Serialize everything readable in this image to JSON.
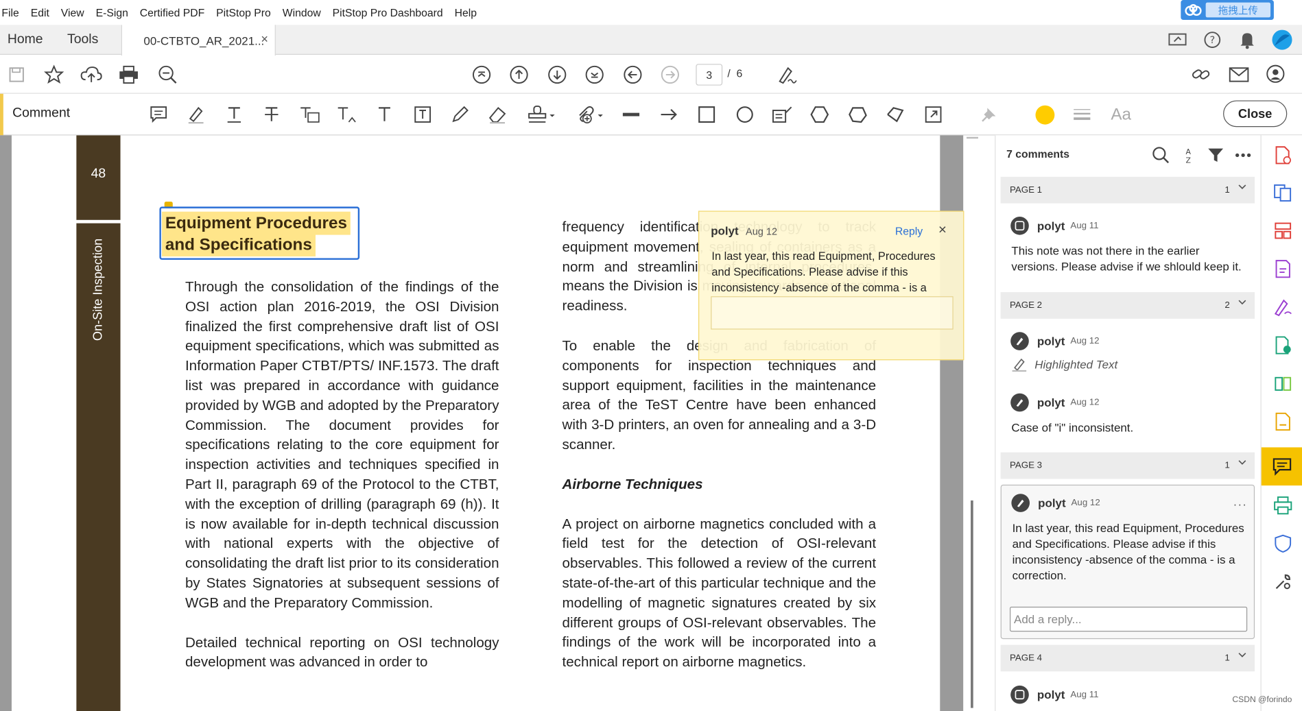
{
  "menu": [
    "File",
    "Edit",
    "View",
    "E-Sign",
    "Certified PDF",
    "PitStop Pro",
    "Window",
    "PitStop Pro Dashboard",
    "Help"
  ],
  "upload_badge": "拖拽上传",
  "tabs": {
    "home": "Home",
    "tools": "Tools",
    "document": "00-CTBTO_AR_2021...",
    "close_glyph": "×"
  },
  "toolbar": {
    "current_page": "3",
    "page_separator": "/",
    "total_pages": "6"
  },
  "comment_toolbar": {
    "title": "Comment",
    "close_label": "Close",
    "text_tool_label": "Aa",
    "color": "#ffcc00"
  },
  "document": {
    "page_number": "48",
    "section_label": "On-Site Inspection",
    "heading_line1": "Equipment Procedures",
    "heading_line2": "and Specifications",
    "col1_p1": "Through the consolidation of the findings of the OSI action plan 2016-2019, the OSI Division finalized the first comprehensive draft list of OSI equipment specifications, which was submitted as Information Paper CTBT/PTS/ INF.1573. The draft list was prepared in accordance with guidance provided by WGB and adopted by the Preparatory Commission. The document provides for specifications relating to the core equipment for inspection activities and techniques specified in Part II, paragraph 69 of the Protocol to the CTBT, with the exception of drilling (paragraph 69 (h)). It is now available for in-depth technical discussion with national experts with the objective of consolidating the draft list prior to its consideration by States Signatories at subsequent sessions of WGB and the Preparatory Commission.",
    "col1_p2": "Detailed technical reporting on OSI technology development was advanced in order to",
    "col2_p1": "frequency identification technology to track equipment movement, sealing of containers as a norm and streamlining of internal procedures, means the Division is moving towards operational readiness.",
    "col2_p2": "To enable the design and fabrication of components for inspection techniques and support equipment, facilities in the maintenance area of the TeST Centre have been enhanced with 3-D printers, an oven for annealing and a 3-D scanner.",
    "col2_heading": "Airborne Techniques",
    "col2_p3": "A project on airborne magnetics concluded with a field test for the detection of OSI-relevant observables. This followed a review of the current state-of-the-art of this particular technique and the modelling of magnetic signatures created by six different groups of OSI-relevant observables. The findings of the work will be incorporated into a technical report on airborne magnetics."
  },
  "popup": {
    "author": "polyt",
    "date": "Aug 12",
    "reply_label": "Reply",
    "close_glyph": "×",
    "body": "In last year, this read Equipment, Procedures and Specifications. Please advise if this inconsistency -absence of the comma - is a"
  },
  "comments_panel": {
    "count_label": "7 comments",
    "groups": [
      {
        "label": "PAGE 1",
        "count": "1"
      },
      {
        "label": "PAGE 2",
        "count": "2"
      },
      {
        "label": "PAGE 3",
        "count": "1"
      },
      {
        "label": "PAGE 4",
        "count": "1"
      }
    ],
    "comments": [
      {
        "author": "polyt",
        "date": "Aug 11",
        "text": "This note was not there in the earlier versions. Please advise if we shlould keep it."
      },
      {
        "author": "polyt",
        "date": "Aug 12",
        "text": "Highlighted Text"
      },
      {
        "author": "polyt",
        "date": "Aug 12",
        "text": "Case of \"i\" inconsistent."
      },
      {
        "author": "polyt",
        "date": "Aug 12",
        "text": "In last year, this read Equipment, Procedures and Specifications. Please advise if this inconsistency -absence of the comma - is a correction."
      },
      {
        "author": "polyt",
        "date": "Aug 11",
        "text": ""
      }
    ],
    "reply_placeholder": "Add a reply...",
    "more_glyph": "···"
  },
  "watermark": "CSDN @forindo"
}
